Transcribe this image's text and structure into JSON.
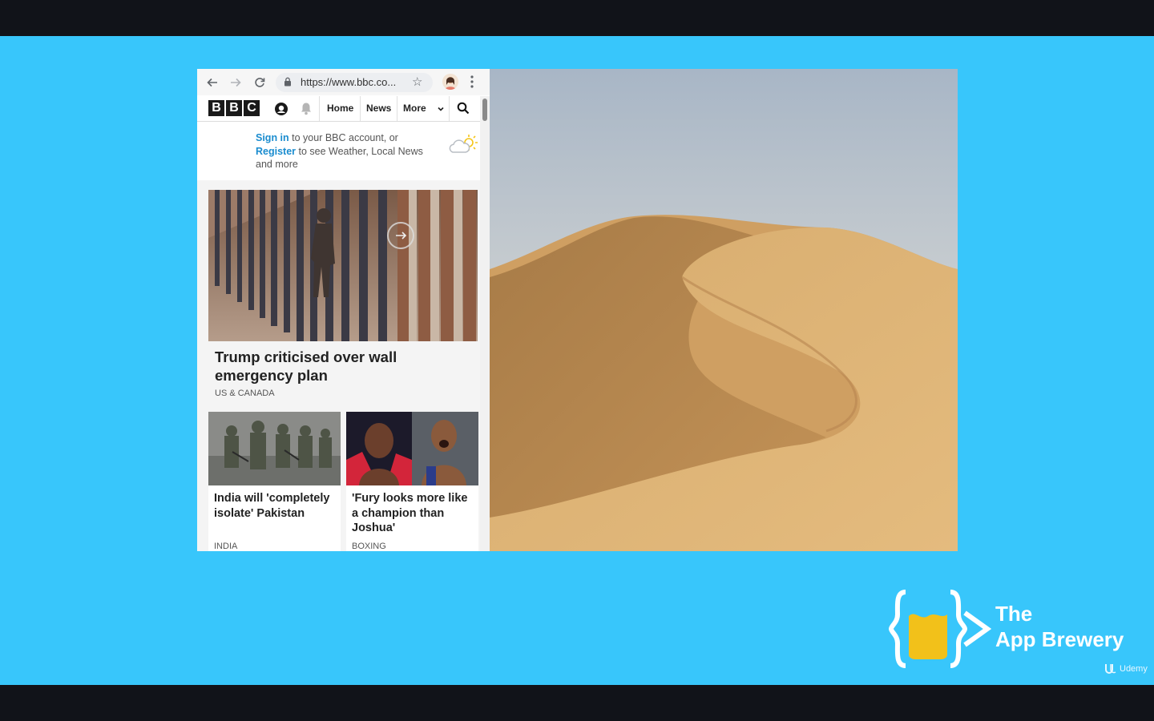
{
  "browser": {
    "url": "https://www.bbc.co...",
    "icons": [
      "back-arrow-icon",
      "forward-arrow-icon",
      "reload-icon",
      "lock-icon",
      "star-icon",
      "profile-avatar",
      "more-vert-icon"
    ]
  },
  "bbc": {
    "logo_letters": [
      "B",
      "B",
      "C"
    ],
    "nav": {
      "home": "Home",
      "news": "News",
      "more": "More"
    },
    "signin": {
      "sign_in": "Sign in",
      "text1": " to your BBC account, or ",
      "register": "Register",
      "text2": " to see Weather, Local News and more"
    },
    "main_story": {
      "title": "Trump criticised over wall emergency plan",
      "tag": "US & CANADA"
    },
    "cards": [
      {
        "title": "India will 'completely isolate' Pakistan",
        "tag": "INDIA"
      },
      {
        "title": "'Fury looks more like a champion than Joshua'",
        "tag": "BOXING"
      }
    ]
  },
  "branding": {
    "the": "The",
    "name": "App Brewery",
    "udemy": "Udemy"
  },
  "colors": {
    "background": "#38c6fb",
    "bbc_link": "#1a8ccf",
    "letterbox": "#111319"
  }
}
